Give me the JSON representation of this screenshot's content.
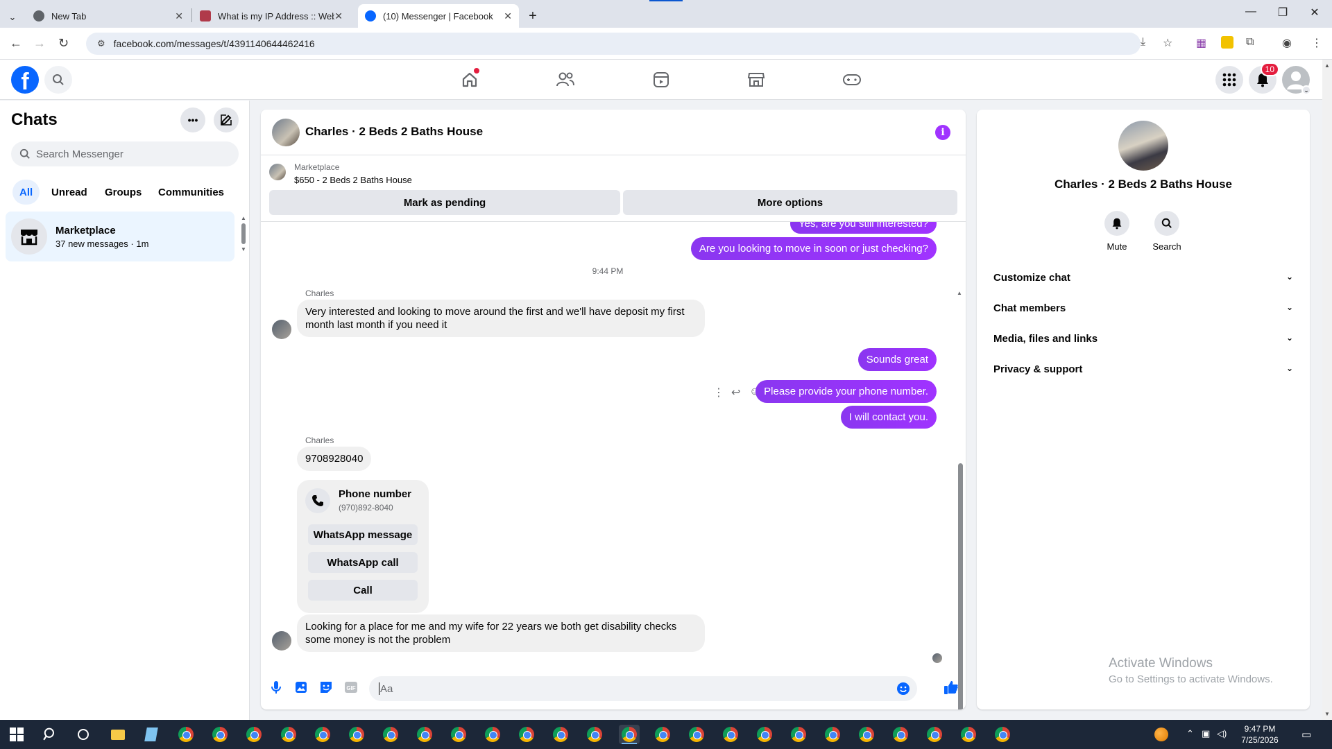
{
  "browser": {
    "tabs": [
      {
        "title": "New Tab",
        "active": false
      },
      {
        "title": "What is my IP Address :: WebBr",
        "active": false
      },
      {
        "title": "(10) Messenger | Facebook",
        "active": true
      }
    ],
    "url": "facebook.com/messages/t/4391140644462416"
  },
  "fbnav": {
    "notification_count": "10"
  },
  "sidebar": {
    "title": "Chats",
    "search_placeholder": "Search Messenger",
    "filters": [
      "All",
      "Unread",
      "Groups",
      "Communities"
    ],
    "active_filter": "All",
    "chats": [
      {
        "name": "Marketplace",
        "subtitle": "37 new messages · 1m"
      }
    ]
  },
  "conversation": {
    "title": "Charles · 2 Beds 2 Baths House",
    "marketplace": {
      "label": "Marketplace",
      "listing": "$650 - 2 Beds 2 Baths House",
      "mark_pending": "Mark as pending",
      "more_options": "More options"
    },
    "messages": {
      "out_partial": "Yes, are you still interested?",
      "out_move": "Are you looking to move in soon or just checking?",
      "timestamp": "9:44 PM",
      "sender1": "Charles",
      "in_interested": "Very interested and looking to move around the first and we'll have deposit my first month last month if you need it",
      "out_sounds": "Sounds great",
      "out_phone": "Please provide your phone number.",
      "out_contact": "I will contact you.",
      "sender2": "Charles",
      "in_number": "9708928040",
      "phone_card": {
        "title": "Phone number",
        "number": "(970)892-8040",
        "buttons": [
          "WhatsApp message",
          "WhatsApp call",
          "Call"
        ]
      },
      "in_looking": "Looking for a place for me and my wife for 22 years we both get disability checks some money is not the problem"
    },
    "composer_placeholder": "Aa"
  },
  "info_panel": {
    "title": "Charles · 2 Beds 2 Baths House",
    "actions": [
      "Mute",
      "Search"
    ],
    "sections": [
      "Customize chat",
      "Chat members",
      "Media, files and links",
      "Privacy & support"
    ]
  },
  "watermark": {
    "line1": "Activate Windows",
    "line2": "Go to Settings to activate Windows."
  },
  "taskbar": {
    "time": "9:47 PM",
    "date": "7/25/2026"
  },
  "colors": {
    "fb_blue": "#0866ff",
    "bubble_purple": "#a033ff",
    "notification_red": "#e41e3f"
  }
}
